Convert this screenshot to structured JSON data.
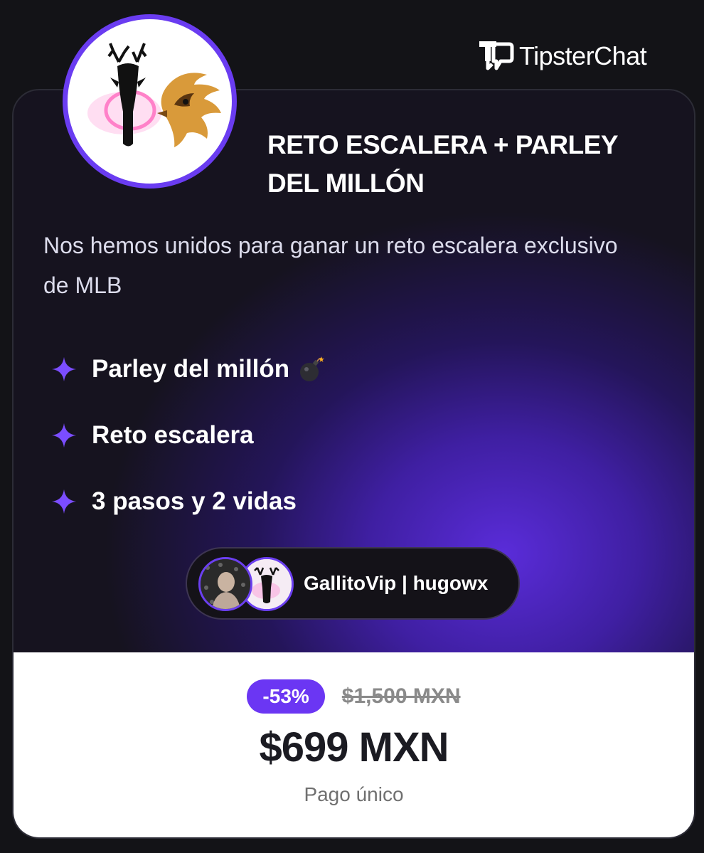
{
  "brand": {
    "name": "TipsterChat",
    "logo": "tipsterchat-logo-icon"
  },
  "offer": {
    "avatar": "deer-and-rooster-logo",
    "title": "RETO ESCALERA + PARLEY DEL MILLÓN",
    "description": "Nos hemos unidos para ganar un reto escalera exclusivo de MLB",
    "features": [
      {
        "icon": "sparkle-icon",
        "text": "Parley del millón",
        "emoji": "bomb-icon"
      },
      {
        "icon": "sparkle-icon",
        "text": "Reto escalera"
      },
      {
        "icon": "sparkle-icon",
        "text": "3 pasos y 2 vidas"
      }
    ],
    "authors": "GallitoVip | hugowx"
  },
  "pricing": {
    "discount": "-53%",
    "original_price": "$1,500 MXN",
    "price": "$699 MXN",
    "note": "Pago único"
  },
  "colors": {
    "accent": "#6b36f3",
    "background": "#131317",
    "card_glow": "#5a2cd9"
  }
}
